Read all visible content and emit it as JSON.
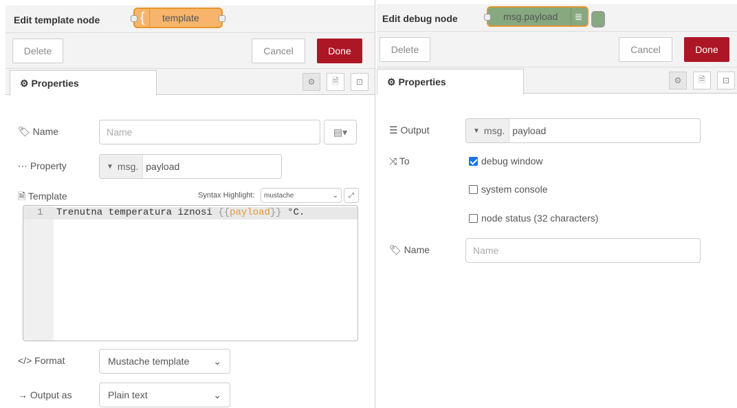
{
  "left": {
    "title": "Edit template node",
    "node_label": "template",
    "node_icon": "{",
    "delete_label": "Delete",
    "cancel_label": "Cancel",
    "done_label": "Done",
    "tab_label": "Properties",
    "name_label": "Name",
    "name_placeholder": "Name",
    "property_label": "Property",
    "property_prefix": "msg.",
    "property_value": "payload",
    "template_label": "Template",
    "syntax_label": "Syntax Highlight:",
    "syntax_value": "mustache",
    "line_number": "1",
    "code_before": "Trenutna temperatura iznosi ",
    "code_open": "{{",
    "code_var": "payload",
    "code_close": "}}",
    "code_after": " °C.",
    "format_label": "Format",
    "format_value": "Mustache template",
    "output_label": "Output as",
    "output_value": "Plain text"
  },
  "right": {
    "title": "Edit debug node",
    "node_label": "msg.payload",
    "delete_label": "Delete",
    "cancel_label": "Cancel",
    "done_label": "Done",
    "tab_label": "Properties",
    "output_label": "Output",
    "output_prefix": "msg.",
    "output_value": "payload",
    "to_label": "To",
    "opt_debug": "debug window",
    "opt_console": "system console",
    "opt_status": "node status (32 characters)",
    "name_label": "Name",
    "name_placeholder": "Name"
  },
  "colors": {
    "done": "#ad1625",
    "template_node": "#f7b46a",
    "debug_node": "#87a980",
    "mustache_var": "#e8952b"
  }
}
